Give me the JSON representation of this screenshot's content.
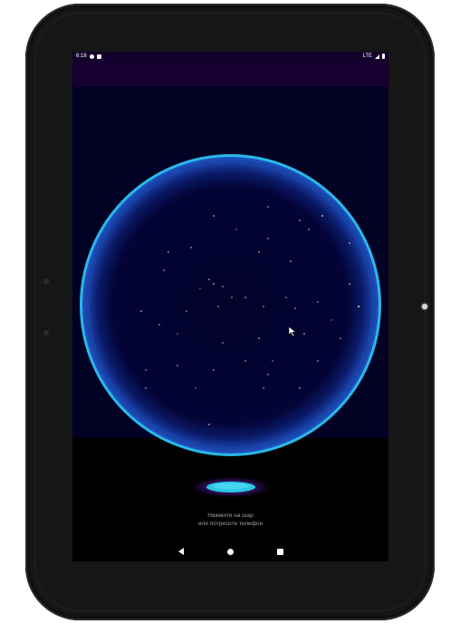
{
  "status_bar": {
    "time": "6:18",
    "network": "LTE"
  },
  "hint": {
    "line1": "Нажмите на шар",
    "line2": "или потрясите телефон"
  },
  "icons": {
    "status_left": [
      "notification-icon",
      "sd-card-icon"
    ],
    "status_right": [
      "signal-icon",
      "battery-icon"
    ],
    "nav": [
      "back-icon",
      "home-icon",
      "recents-icon"
    ]
  },
  "colors": {
    "status_bar_bg": "#12002a",
    "app_bar_bg": "#150031",
    "content_bg": "#010124",
    "sphere_rim": "#2ab8e8",
    "pedestal_glow": "#27c7e6"
  }
}
